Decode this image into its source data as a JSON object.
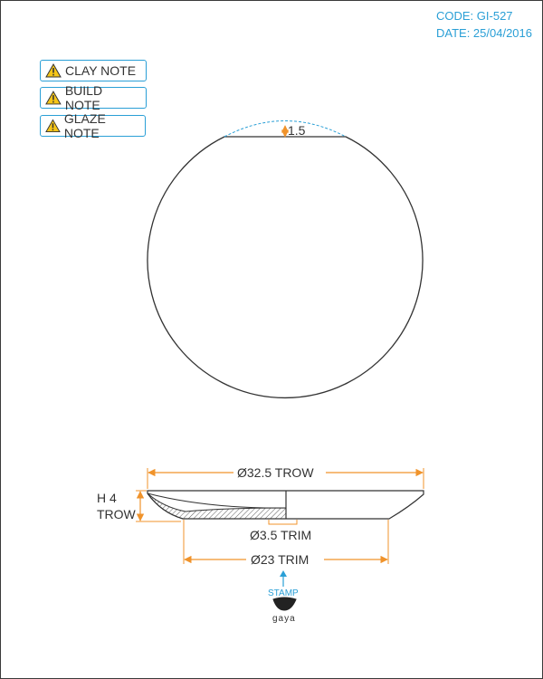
{
  "header": {
    "code": "CODE: GI-527",
    "date": "DATE: 25/04/2016"
  },
  "notes": [
    {
      "label": "CLAY NOTE"
    },
    {
      "label": "BUILD NOTE"
    },
    {
      "label": "GLAZE NOTE"
    }
  ],
  "dimensions": {
    "rim_depth": "1.5",
    "outer_diameter": "Ø32.5 TROW",
    "height_line1": "H 4",
    "height_line2": "TROW",
    "foot_inner": "Ø3.5 TRIM",
    "foot_outer": "Ø23 TRIM"
  },
  "stamp": {
    "label": "STAMP",
    "brand": "gaya"
  },
  "colors": {
    "accent_blue": "#2a9fd6",
    "dimension_orange": "#f0932b",
    "line": "#333333",
    "warning_yellow": "#f5c518"
  }
}
